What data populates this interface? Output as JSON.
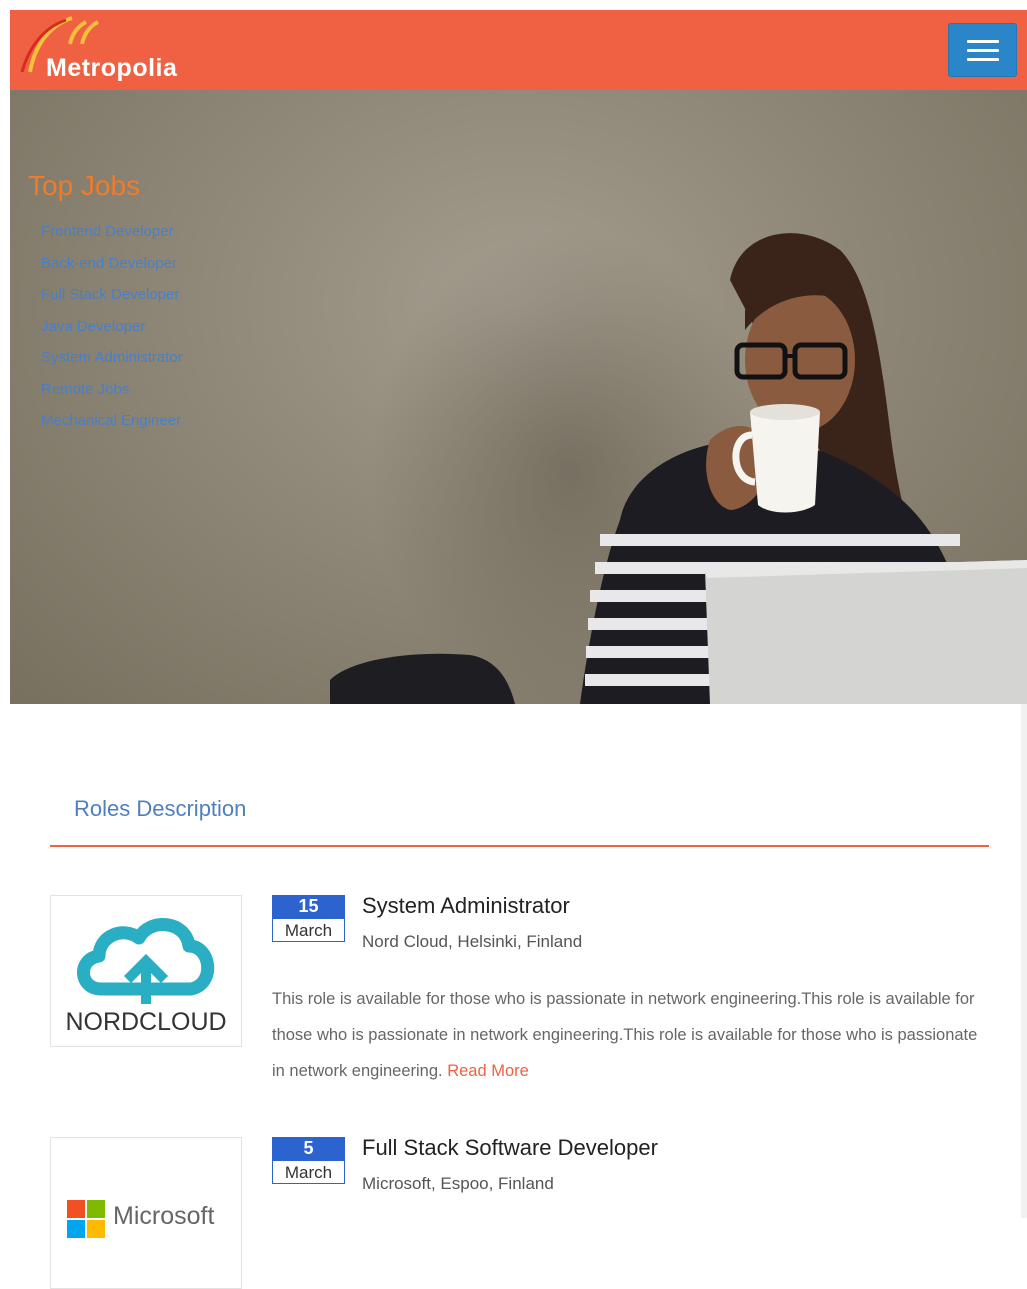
{
  "header": {
    "logo_text": "Metropolia",
    "brand_color": "#ef6142",
    "menu_icon": "hamburger-icon"
  },
  "hero": {
    "title": "Top Jobs",
    "links": [
      "Frontend Developer",
      "Back-end Developer",
      "Full Stack Developer",
      "Java Developer",
      "System Administrator",
      "Remote Jobs",
      "Mechanical Engineer"
    ]
  },
  "section": {
    "title": "Roles Description"
  },
  "jobs": [
    {
      "day": "15",
      "month": "March",
      "title": "System Administrator",
      "company": "Nord Cloud, Helsinki, Finland",
      "logo_text": "NORDCLOUD",
      "description": "This role is available for those who is passionate in network engineering.This role is available for those who is passionate in network engineering.This role is available for those who is passionate in network engineering.",
      "read_more": "Read More"
    },
    {
      "day": "5",
      "month": "March",
      "title": "Full Stack Software Developer",
      "company": "Microsoft, Espoo, Finland",
      "logo_text": "Microsoft"
    }
  ]
}
